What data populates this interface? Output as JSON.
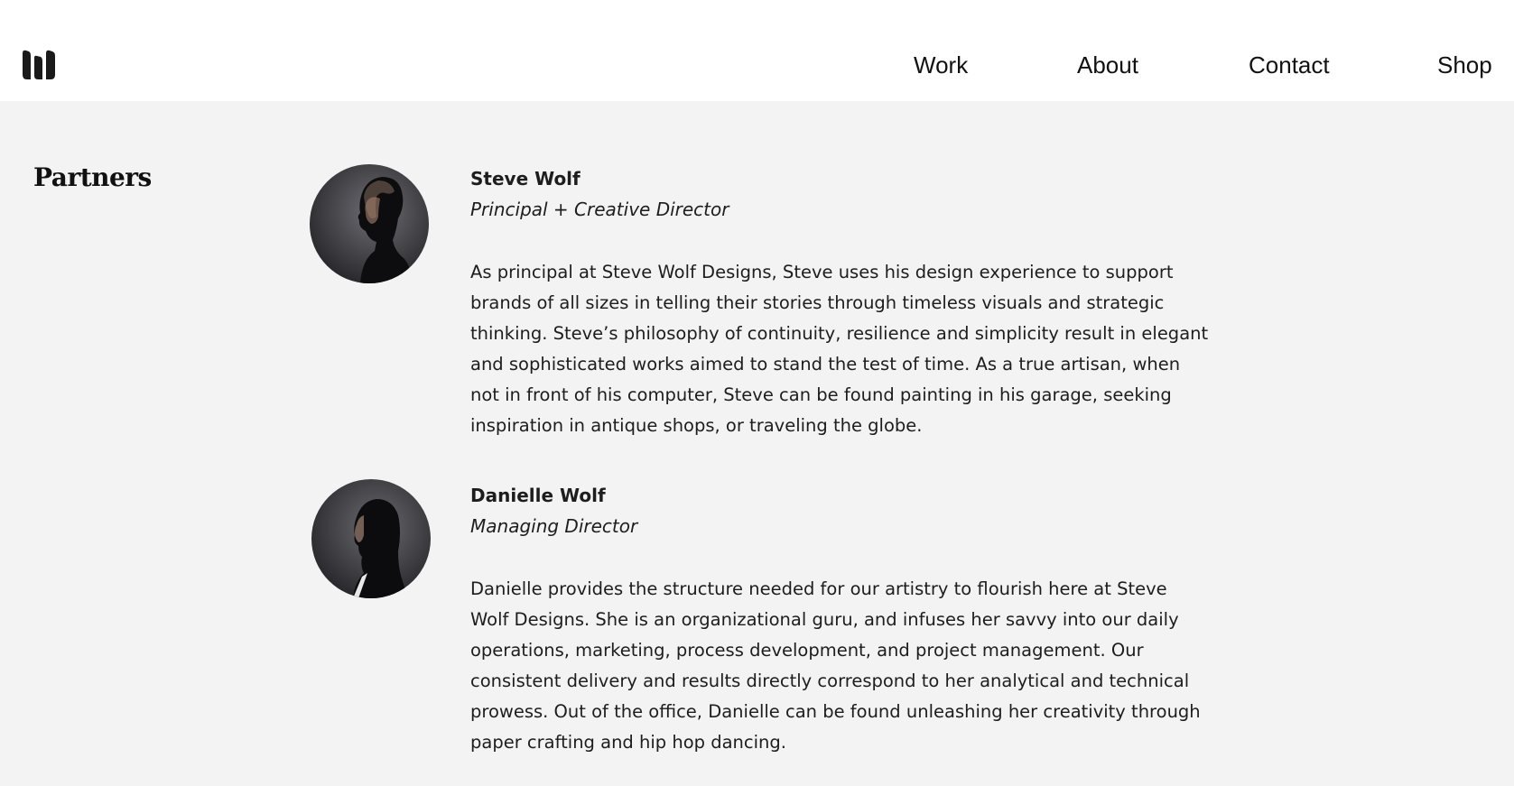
{
  "brand": {
    "logo_icon": "wolf-w-logo-icon"
  },
  "nav": {
    "items": [
      {
        "label": "Work"
      },
      {
        "label": "About"
      },
      {
        "label": "Contact"
      },
      {
        "label": "Shop"
      }
    ]
  },
  "section": {
    "title": "Partners"
  },
  "partners": [
    {
      "name": "Steve Wolf",
      "role": "Principal + Creative Director",
      "bio": "As principal at Steve Wolf Designs, Steve uses his design experience to support brands of all sizes in telling their stories through timeless visuals and strategic thinking. Steve’s philosophy of continuity, resilience and simplicity result in elegant and sophisticated works aimed to stand the test of time. As a true artisan, when not in front of his computer, Steve can be found painting in his garage, seeking inspiration in antique shops, or traveling the globe."
    },
    {
      "name": "Danielle Wolf",
      "role": "Managing Director",
      "bio": "Danielle provides the structure needed for our artistry to flourish here at Steve Wolf Designs. She is an organizational guru, and infuses her savvy into our daily operations, marketing, process development, and project management. Our consistent delivery and results directly correspond to her analytical and technical prowess. Out of the office, Danielle can be found unleashing her creativity through paper crafting and hip hop dancing."
    }
  ],
  "colors": {
    "background": "#f3f3f3",
    "header": "#ffffff",
    "text": "#1d1d1d"
  }
}
